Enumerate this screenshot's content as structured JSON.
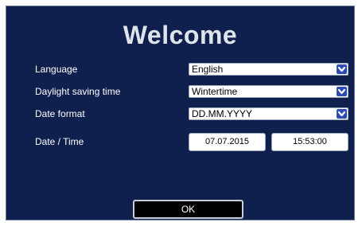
{
  "title": "Welcome",
  "settings": [
    {
      "label": "Language",
      "value": "English"
    },
    {
      "label": "Daylight saving time",
      "value": "Wintertime"
    },
    {
      "label": "Date format",
      "value": "DD.MM.YYYY"
    }
  ],
  "datetime": {
    "label": "Date / Time",
    "date": "07.07.2015",
    "time": "15:53:00"
  },
  "ok_label": "OK",
  "colors": {
    "background": "#10204e",
    "title": "#dfe3ec",
    "dropdown_button": "#2c4bb4"
  },
  "icons": {
    "dropdown": "chevron-down-icon"
  }
}
